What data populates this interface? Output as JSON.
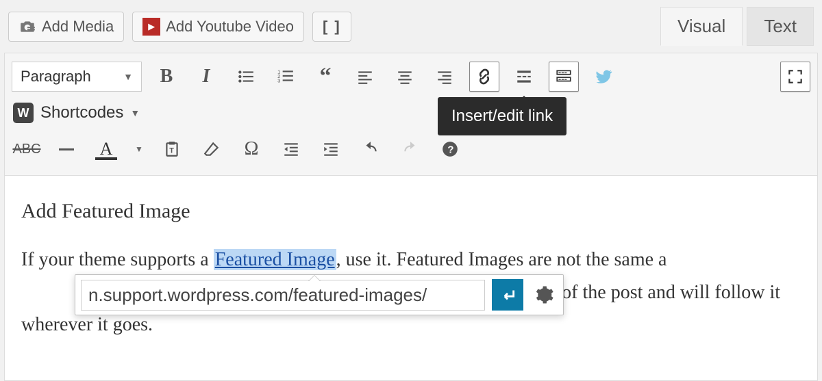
{
  "top": {
    "add_media": "Add Media",
    "add_youtube": "Add Youtube Video",
    "brackets": "[ ]"
  },
  "tabs": {
    "visual": "Visual",
    "text": "Text"
  },
  "toolbar": {
    "format": "Paragraph",
    "shortcodes": "Shortcodes",
    "link_tooltip": "Insert/edit link",
    "abc": "ABC",
    "textcolor_letter": "A",
    "omega": "Ω"
  },
  "content": {
    "heading": "Add Featured Image",
    "p1a": "If your theme supports a ",
    "link_text": "Featured Image",
    "p1b": ", use it. Featured Images are not the same a",
    "p1c": "cover of the post and will follow it wherever it goes."
  },
  "link_popup": {
    "value": "n.support.wordpress.com/featured-images/"
  }
}
